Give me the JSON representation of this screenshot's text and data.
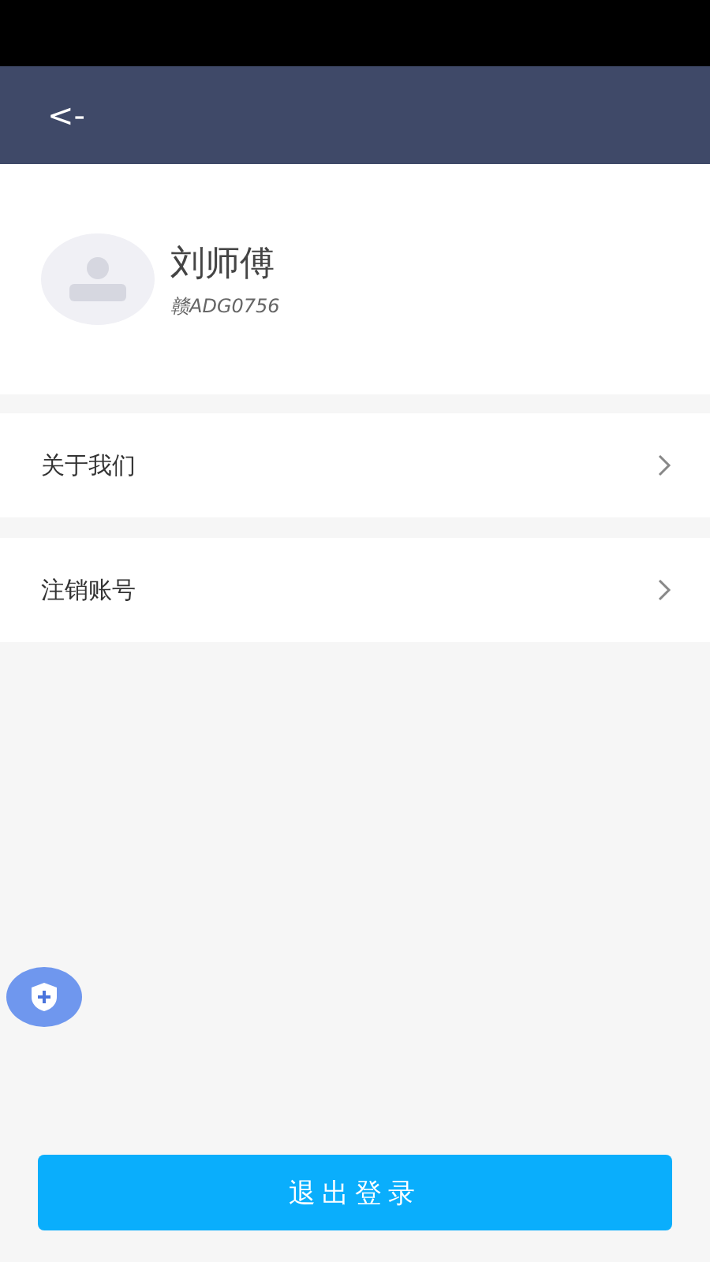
{
  "header": {
    "back": "<-"
  },
  "profile": {
    "name": "刘师傅",
    "plate": "赣ADG0756"
  },
  "menu": [
    {
      "label": "关于我们"
    },
    {
      "label": "注销账号"
    }
  ],
  "logout": "退出登录"
}
